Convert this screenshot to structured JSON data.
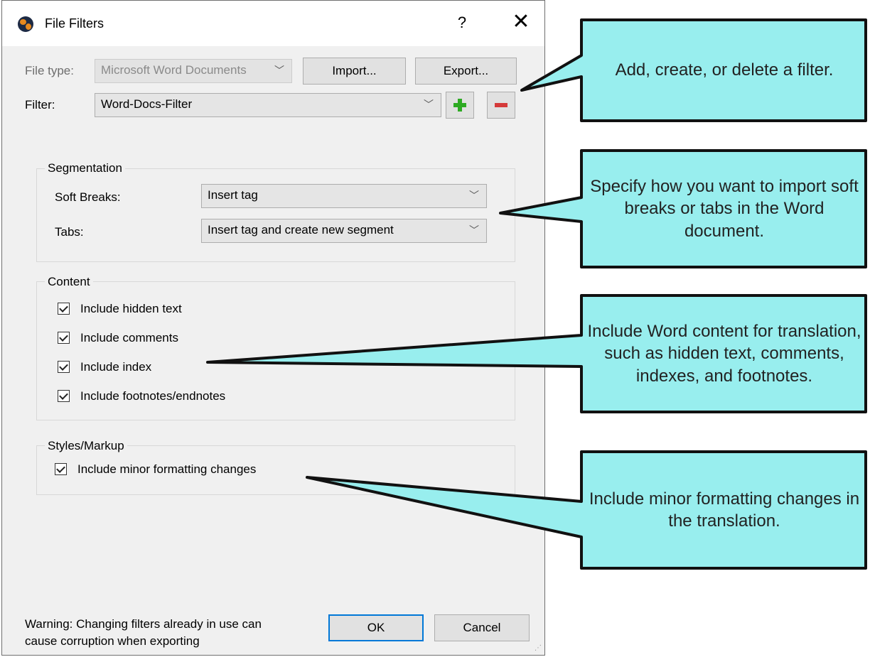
{
  "window": {
    "title": "File Filters",
    "help_label": "?",
    "close_label": "✕"
  },
  "file_type": {
    "label": "File type:",
    "value": "Microsoft Word Documents"
  },
  "buttons": {
    "import": "Import...",
    "export": "Export...",
    "ok": "OK",
    "cancel": "Cancel"
  },
  "filter": {
    "label": "Filter:",
    "value": "Word-Docs-Filter",
    "add_icon": "plus-icon",
    "remove_icon": "minus-icon"
  },
  "segmentation": {
    "title": "Segmentation",
    "soft_breaks_label": "Soft Breaks:",
    "soft_breaks_value": "Insert tag",
    "tabs_label": "Tabs:",
    "tabs_value": "Insert tag and create new segment"
  },
  "content": {
    "title": "Content",
    "items": [
      {
        "label": "Include hidden text",
        "checked": true
      },
      {
        "label": "Include comments",
        "checked": true
      },
      {
        "label": "Include index",
        "checked": true
      },
      {
        "label": "Include footnotes/endnotes",
        "checked": true
      }
    ]
  },
  "styles": {
    "title": "Styles/Markup",
    "items": [
      {
        "label": "Include minor formatting changes",
        "checked": true
      }
    ]
  },
  "warning": {
    "line1": "Warning: Changing filters already in use can",
    "line2": "cause corruption when exporting"
  },
  "callouts": {
    "color": "#98eeee",
    "items": [
      {
        "text": "Add, create, or delete a filter."
      },
      {
        "text": "Specify how you want to import soft breaks or tabs in the Word document."
      },
      {
        "text": "Include Word content for translation, such as hidden text, comments, indexes, and footnotes."
      },
      {
        "text": "Include minor formatting changes in the translation."
      }
    ]
  }
}
